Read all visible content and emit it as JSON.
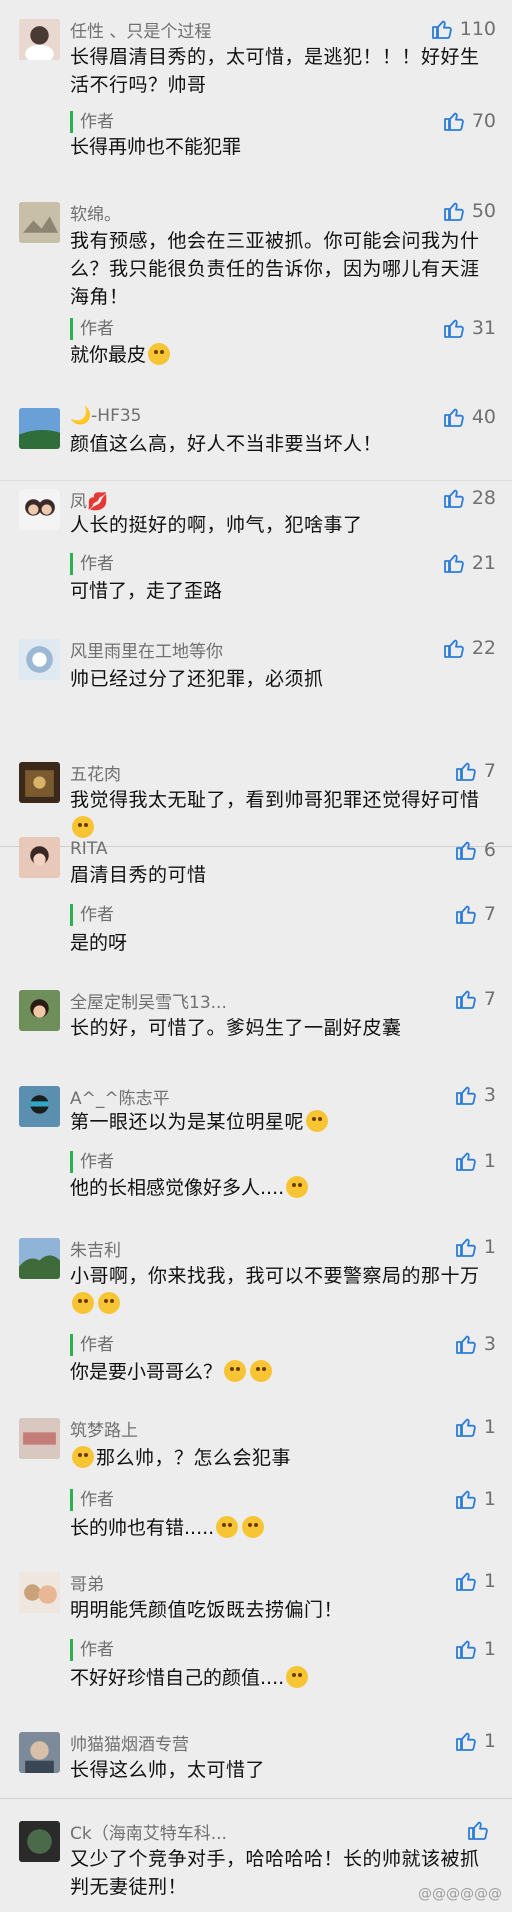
{
  "comments": [
    {
      "nick": "任性 、只是个过程",
      "likes": "110",
      "text": "长得眉清目秀的，太可惜，是逃犯！！！好好生活不行吗？帅哥",
      "reply_tag": "作者",
      "reply_likes": "70",
      "reply_text": "长得再帅也不能犯罪"
    },
    {
      "nick": "软绵。",
      "likes": "50",
      "text": "我有预感，他会在三亚被抓。你可能会问我为什么？我只能很负责任的告诉你，因为哪儿有天涯海角！",
      "reply_tag": "作者",
      "reply_likes": "31",
      "reply_text": "就你最皮"
    },
    {
      "nick": "🌙-HF35",
      "likes": "40",
      "text": "颜值这么高，好人不当非要当坏人！"
    },
    {
      "nick": "凤💋",
      "likes": "28",
      "text": "人长的挺好的啊，帅气，犯啥事了",
      "reply_tag": "作者",
      "reply_likes": "21",
      "reply_text": "可惜了，走了歪路"
    },
    {
      "nick": "风里雨里在工地等你",
      "likes": "22",
      "text": "帅已经过分了还犯罪，必须抓"
    },
    {
      "nick": "五花肉",
      "likes": "7",
      "text": "我觉得我太无耻了，看到帅哥犯罪还觉得好可惜"
    },
    {
      "nick": "RITA",
      "likes": "6",
      "text": "眉清目秀的可惜",
      "reply_tag": "作者",
      "reply_likes": "7",
      "reply_text": "是的呀"
    },
    {
      "nick": "全屋定制吴雪飞13...",
      "likes": "7",
      "text": "长的好，可惜了。爹妈生了一副好皮囊"
    },
    {
      "nick": "A^_^陈志平",
      "likes": "3",
      "text": "第一眼还以为是某位明星呢",
      "reply_tag": "作者",
      "reply_likes": "1",
      "reply_text": "他的长相感觉像好多人...."
    },
    {
      "nick": "朱吉利",
      "likes": "1",
      "text": "小哥啊，你来找我，我可以不要警察局的那十万",
      "reply_tag": "作者",
      "reply_likes": "3",
      "reply_text": "你是要小哥哥么？"
    },
    {
      "nick": "筑梦路上",
      "likes": "1",
      "text": "那么帅，？怎么会犯事",
      "reply_tag": "作者",
      "reply_likes": "1",
      "reply_text": "长的帅也有错....."
    },
    {
      "nick": "哥弟",
      "likes": "1",
      "text": "明明能凭颜值吃饭既去捞偏门！",
      "reply_tag": "作者",
      "reply_likes": "1",
      "reply_text": "不好好珍惜自己的颜值...."
    },
    {
      "nick": "帅猫猫烟酒专营",
      "likes": "1",
      "text": "长得这么帅，太可惜了"
    },
    {
      "nick": "Ck（海南艾特车科...",
      "likes": "",
      "text": "又少了个竞争对手，哈哈哈哈！长的帅就该被抓判无妻徒刑！"
    }
  ],
  "watermark": "@@@@@@",
  "colors": {
    "accent_bar": "#2bb24c",
    "meta_text": "#707070",
    "background": "#ededed"
  },
  "icons": {
    "like": "thumbs-up-icon"
  }
}
